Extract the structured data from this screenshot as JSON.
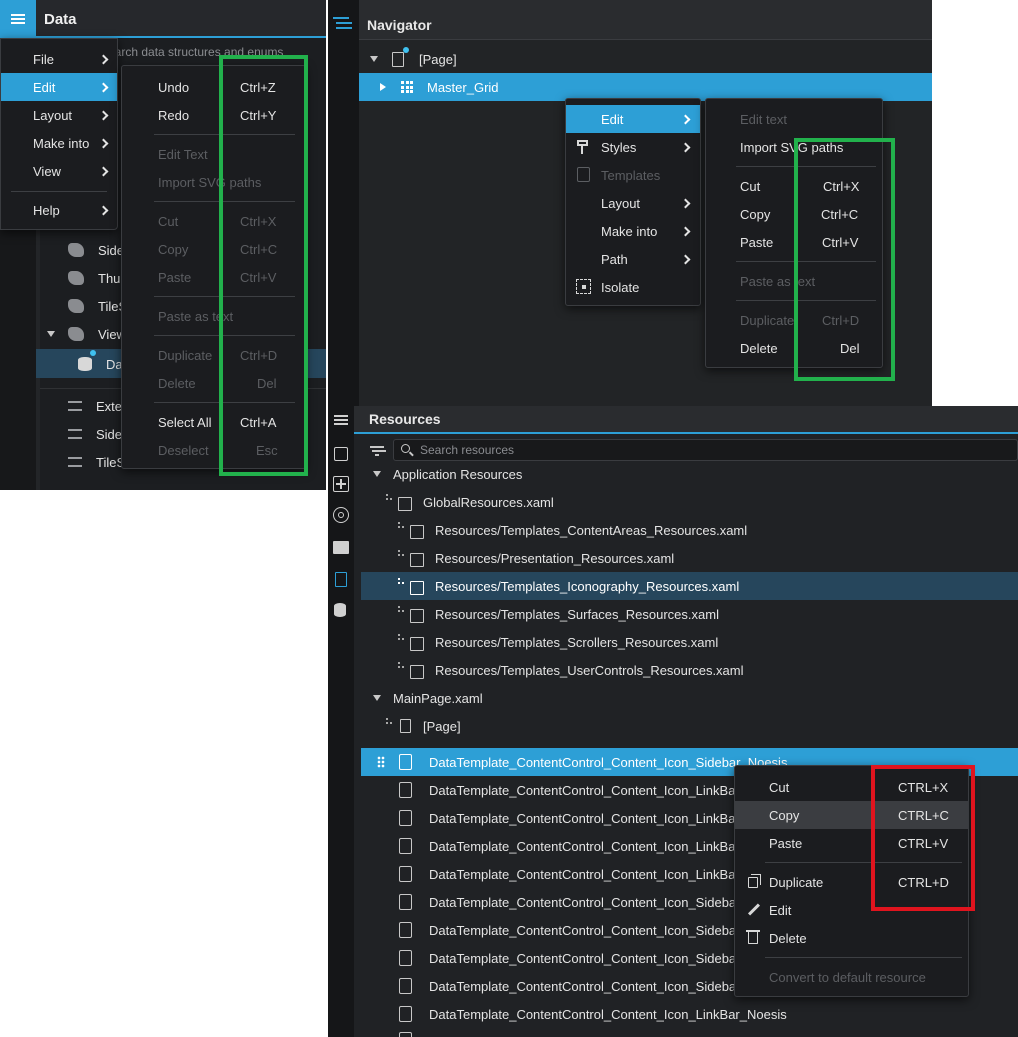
{
  "data_panel": {
    "title": "Data",
    "search_placeholder": "Search data structures and enums",
    "tree_items": [
      "Side",
      "Thu",
      "TileS",
      "View",
      "Da",
      "Exte",
      "Side",
      "TileS"
    ],
    "menubar": [
      {
        "label": "File"
      },
      {
        "label": "Edit"
      },
      {
        "label": "Layout"
      },
      {
        "label": "Make into"
      },
      {
        "label": "View"
      },
      {
        "label": "Help"
      }
    ],
    "edit_submenu": [
      {
        "label": "Undo",
        "shortcut": "Ctrl+Z",
        "enabled": true
      },
      {
        "label": "Redo",
        "shortcut": "Ctrl+Y",
        "enabled": true
      },
      {
        "label": "Edit Text",
        "shortcut": "",
        "enabled": false
      },
      {
        "label": "Import SVG paths",
        "shortcut": "",
        "enabled": false
      },
      {
        "label": "Cut",
        "shortcut": "Ctrl+X",
        "enabled": false
      },
      {
        "label": "Copy",
        "shortcut": "Ctrl+C",
        "enabled": false
      },
      {
        "label": "Paste",
        "shortcut": "Ctrl+V",
        "enabled": false
      },
      {
        "label": "Paste as text",
        "shortcut": "",
        "enabled": false
      },
      {
        "label": "Duplicate",
        "shortcut": "Ctrl+D",
        "enabled": false
      },
      {
        "label": "Delete",
        "shortcut": "Del",
        "enabled": false
      },
      {
        "label": "Select All",
        "shortcut": "Ctrl+A",
        "enabled": true
      },
      {
        "label": "Deselect",
        "shortcut": "Esc",
        "enabled": false
      }
    ]
  },
  "navigator": {
    "title": "Navigator",
    "page_item": "[Page]",
    "grid_item": "Master_Grid",
    "context_menu": [
      {
        "label": "Edit",
        "icon": "",
        "enabled": true
      },
      {
        "label": "Styles",
        "icon": "paint-roller-icon",
        "enabled": true
      },
      {
        "label": "Templates",
        "icon": "template-icon",
        "enabled": false
      },
      {
        "label": "Layout",
        "icon": "",
        "enabled": true
      },
      {
        "label": "Make into",
        "icon": "",
        "enabled": true
      },
      {
        "label": "Path",
        "icon": "",
        "enabled": true
      },
      {
        "label": "Isolate",
        "icon": "isolate-icon",
        "enabled": true
      }
    ],
    "edit_submenu": [
      {
        "label": "Edit text",
        "shortcut": "",
        "enabled": false
      },
      {
        "label": "Import SVG paths",
        "shortcut": "",
        "enabled": true
      },
      {
        "label": "Cut",
        "shortcut": "Ctrl+X",
        "enabled": true
      },
      {
        "label": "Copy",
        "shortcut": "Ctrl+C",
        "enabled": true
      },
      {
        "label": "Paste",
        "shortcut": "Ctrl+V",
        "enabled": true
      },
      {
        "label": "Paste as text",
        "shortcut": "",
        "enabled": false
      },
      {
        "label": "Duplicate",
        "shortcut": "Ctrl+D",
        "enabled": false
      },
      {
        "label": "Delete",
        "shortcut": "Del",
        "enabled": true
      }
    ]
  },
  "resources": {
    "title": "Resources",
    "search_placeholder": "Search resources",
    "app_group": "Application Resources",
    "global_file": "GlobalResources.xaml",
    "app_files": [
      "Resources/Templates_ContentAreas_Resources.xaml",
      "Resources/Presentation_Resources.xaml",
      "Resources/Templates_Iconography_Resources.xaml",
      "Resources/Templates_Surfaces_Resources.xaml",
      "Resources/Templates_Scrollers_Resources.xaml",
      "Resources/Templates_UserControls_Resources.xaml"
    ],
    "main_group": "MainPage.xaml",
    "page_item": "[Page]",
    "templates": [
      "DataTemplate_ContentControl_Content_Icon_Sidebar_Noesis",
      "DataTemplate_ContentControl_Content_Icon_LinkBar_",
      "DataTemplate_ContentControl_Content_Icon_LinkBar_",
      "DataTemplate_ContentControl_Content_Icon_LinkBar_",
      "DataTemplate_ContentControl_Content_Icon_LinkBar_",
      "DataTemplate_ContentControl_Content_Icon_Sidebar_",
      "DataTemplate_ContentControl_Content_Icon_Sidebar_",
      "DataTemplate_ContentControl_Content_Icon_Sidebar_",
      "DataTemplate_ContentControl_Content_Icon_Sidebar_",
      "DataTemplate_ContentControl_Content_Icon_LinkBar_Noesis"
    ],
    "context_menu": [
      {
        "label": "Cut",
        "shortcut": "CTRL+X",
        "enabled": true
      },
      {
        "label": "Copy",
        "shortcut": "CTRL+C",
        "enabled": true
      },
      {
        "label": "Paste",
        "shortcut": "CTRL+V",
        "enabled": true
      },
      {
        "label": "Duplicate",
        "shortcut": "CTRL+D",
        "enabled": true
      },
      {
        "label": "Edit",
        "shortcut": "",
        "enabled": true
      },
      {
        "label": "Delete",
        "shortcut": "",
        "enabled": true
      },
      {
        "label": "Convert to default resource",
        "shortcut": "",
        "enabled": false
      }
    ]
  },
  "colors": {
    "accent": "#2d9fd6",
    "panel_bg": "#1f2124",
    "menu_bg": "#1b1c1f",
    "highlight_green": "#22b14c",
    "highlight_red": "#e0141e"
  }
}
